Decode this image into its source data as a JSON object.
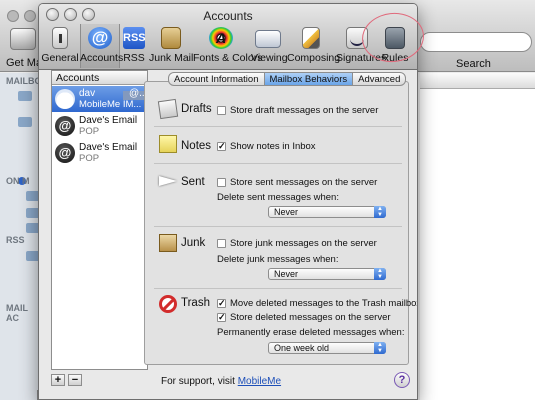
{
  "background_app": {
    "toolbar": {
      "get_mail_label": "Get Mail",
      "search_label": "Search"
    },
    "sidebar_sections": [
      "MAILBO",
      "ON M",
      "RSS",
      "MAIL AC"
    ]
  },
  "window": {
    "title": "Accounts",
    "toolbar": {
      "items": [
        {
          "label": "General",
          "icon": "general-switch-icon",
          "selected": false
        },
        {
          "label": "Accounts",
          "icon": "at-sign-icon",
          "selected": true
        },
        {
          "label": "RSS",
          "icon": "rss-icon",
          "selected": false
        },
        {
          "label": "Junk Mail",
          "icon": "junk-mail-bag-icon",
          "selected": false
        },
        {
          "label": "Fonts & Colors",
          "icon": "color-wheel-icon",
          "selected": false
        },
        {
          "label": "Viewing",
          "icon": "glasses-icon",
          "selected": false
        },
        {
          "label": "Composing",
          "icon": "pencil-paper-icon",
          "selected": false
        },
        {
          "label": "Signatures",
          "icon": "signature-icon",
          "selected": false
        },
        {
          "label": "Rules",
          "icon": "rules-icon",
          "selected": false
        }
      ],
      "highlight_color": "#e06a7c"
    },
    "accounts": {
      "header": "Accounts",
      "items": [
        {
          "name": "dav",
          "name_suffix": "@...",
          "type": "MobileMe IM...",
          "icon": "cloud-icon",
          "selected": true
        },
        {
          "name": "Dave's Email",
          "type": "POP",
          "icon": "at-sign-icon",
          "selected": false
        },
        {
          "name": "Dave's Email",
          "type": "POP",
          "icon": "at-sign-icon",
          "selected": false
        }
      ],
      "add_label": "+",
      "remove_label": "−"
    },
    "tabs": [
      {
        "label": "Account Information",
        "active": false
      },
      {
        "label": "Mailbox Behaviors",
        "active": true
      },
      {
        "label": "Advanced",
        "active": false
      }
    ],
    "sections": {
      "drafts": {
        "title": "Drafts",
        "store_on_server": {
          "label": "Store draft messages on the server",
          "checked": false
        }
      },
      "notes": {
        "title": "Notes",
        "show_in_inbox": {
          "label": "Show notes in Inbox",
          "checked": true
        }
      },
      "sent": {
        "title": "Sent",
        "store_on_server": {
          "label": "Store sent messages on the server",
          "checked": false
        },
        "delete_label": "Delete sent messages when:",
        "delete_value": "Never"
      },
      "junk": {
        "title": "Junk",
        "store_on_server": {
          "label": "Store junk messages on the server",
          "checked": false
        },
        "delete_label": "Delete junk messages when:",
        "delete_value": "Never"
      },
      "trash": {
        "title": "Trash",
        "move_to_trash": {
          "label": "Move deleted messages to the Trash mailbox",
          "checked": true
        },
        "store_on_server": {
          "label": "Store deleted messages on the server",
          "checked": true
        },
        "erase_label": "Permanently erase deleted messages when:",
        "erase_value": "One week old"
      }
    },
    "support": {
      "text": "For support, visit",
      "link": "MobileMe"
    },
    "help_label": "?"
  },
  "colors": {
    "selection_blue": "#2f68cf",
    "link_blue": "#1d4fb8",
    "trash_red": "#d22c2c"
  }
}
